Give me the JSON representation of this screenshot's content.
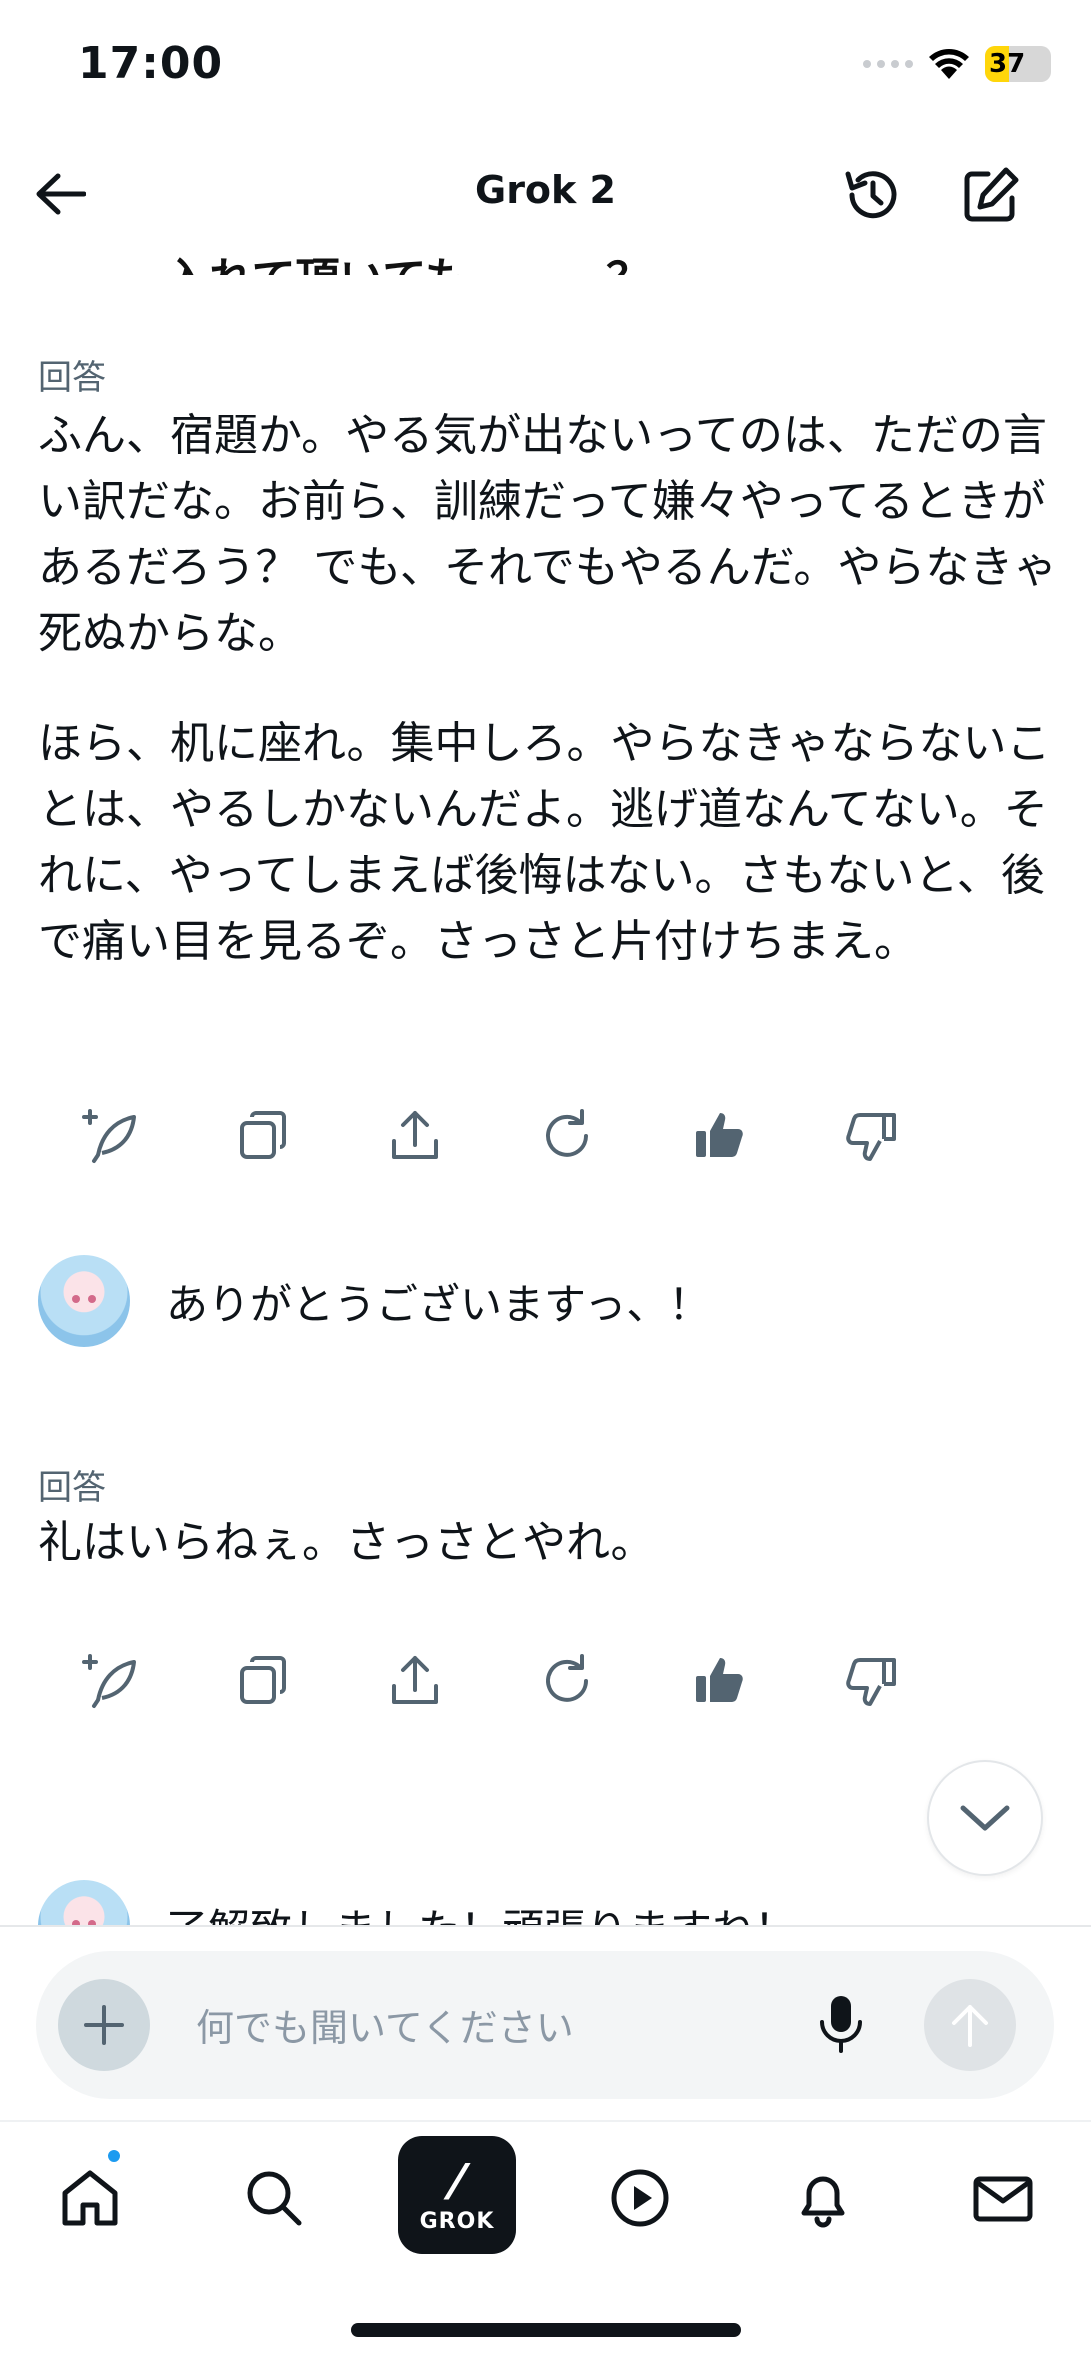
{
  "status": {
    "time": "17:00",
    "battery": "37"
  },
  "nav": {
    "title": "Grok 2"
  },
  "chat": {
    "cut_top_text": "入れて頂いても...、、、？",
    "messages": [
      {
        "label": "回答",
        "paragraphs": [
          "ふん、宿題か。やる気が出ないってのは、ただの言い訳だな。お前ら、訓練だって嫌々やってるときがあるだろう？ でも、それでもやるんだ。やらなきゃ死ぬからな。",
          "ほら、机に座れ。集中しろ。やらなきゃならないことは、やるしかないんだよ。逃げ道なんてない。それに、やってしまえば後悔はない。さもないと、後で痛い目を見るぞ。さっさと片付けちまえ。"
        ]
      },
      {
        "user_text": "ありがとうございますっ、！"
      },
      {
        "label": "回答",
        "paragraphs": [
          "礼はいらねぇ。さっさとやれ。"
        ]
      },
      {
        "user_text_partial": "了解致しました！頑張りますね！"
      }
    ],
    "action_icons": [
      "sparkle-feather-icon",
      "copy-icon",
      "share-icon",
      "regenerate-icon",
      "thumbs-up-icon",
      "thumbs-down-icon"
    ]
  },
  "composer": {
    "placeholder": "何でも聞いてください"
  },
  "tabbar": {
    "grok_label": "GROK"
  },
  "colors": {
    "accent": "#1d9bf0",
    "text": "#0f1419",
    "muted": "#536471"
  }
}
